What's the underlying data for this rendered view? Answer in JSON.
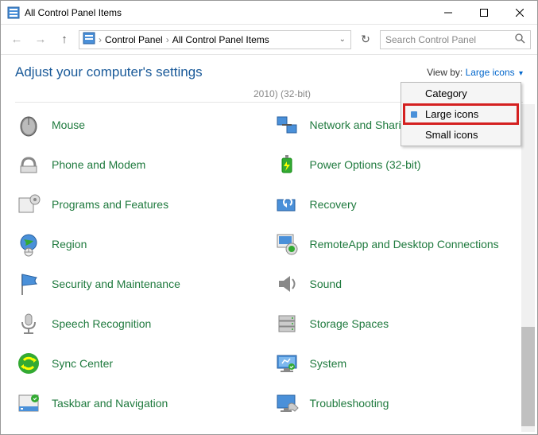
{
  "titlebar": {
    "title": "All Control Panel Items"
  },
  "breadcrumb": {
    "part1": "Control Panel",
    "part2": "All Control Panel Items"
  },
  "search": {
    "placeholder": "Search Control Panel"
  },
  "heading": "Adjust your computer's settings",
  "viewby": {
    "label": "View by:",
    "current": "Large icons"
  },
  "partial": "2010) (32-bit)",
  "dropdown": {
    "opt1": "Category",
    "opt2": "Large icons",
    "opt3": "Small icons"
  },
  "items": {
    "left": [
      "Mouse",
      "Phone and Modem",
      "Programs and Features",
      "Region",
      "Security and Maintenance",
      "Speech Recognition",
      "Sync Center",
      "Taskbar and Navigation"
    ],
    "right": [
      "Network and Sharing Center",
      "Power Options (32-bit)",
      "Recovery",
      "RemoteApp and Desktop Connections",
      "Sound",
      "Storage Spaces",
      "System",
      "Troubleshooting"
    ]
  }
}
